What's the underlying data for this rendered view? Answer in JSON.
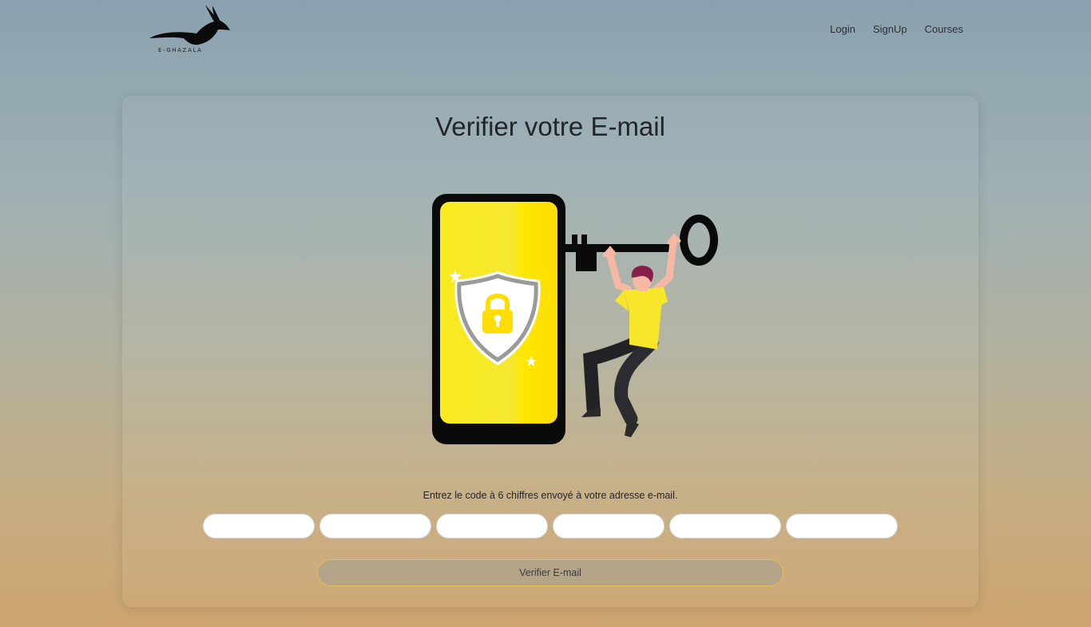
{
  "header": {
    "logo_text": "E-GHAZALA",
    "nav": [
      {
        "label": "Login"
      },
      {
        "label": "SignUp"
      },
      {
        "label": "Courses"
      }
    ]
  },
  "card": {
    "title": "Verifier votre E-mail",
    "instruction": "Entrez le code à 6 chiffres envoyé à votre adresse e-mail.",
    "code_digits": [
      "",
      "",
      "",
      "",
      "",
      ""
    ],
    "submit_label": "Verifier E-mail"
  },
  "icons": {
    "logo": "gazelle-logo-icon",
    "illustration": "phone-security-key-illustration"
  },
  "colors": {
    "accent_yellow": "#ffe600",
    "button_border": "#e3c24e"
  }
}
